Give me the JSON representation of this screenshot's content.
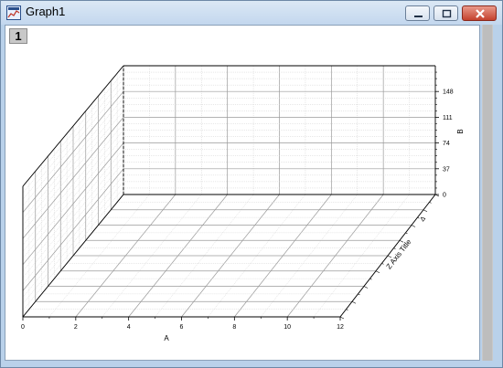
{
  "window": {
    "title": "Graph1",
    "icon": "origin-graph-icon",
    "controls": {
      "minimize": "minimize-icon",
      "maximize": "maximize-icon",
      "close": "close-icon"
    }
  },
  "layer": {
    "label": "1"
  },
  "chart_data": {
    "type": "3d-scatter",
    "x": {
      "label": "A",
      "ticks": [
        "0",
        "2",
        "4",
        "6",
        "8",
        "10",
        "12"
      ]
    },
    "y": {
      "label": "B",
      "ticks": [
        "0",
        "37",
        "74",
        "111",
        "148"
      ]
    },
    "z": {
      "label": "Z Axis Title",
      "ticks": [
        "Δ"
      ]
    },
    "series": [],
    "grid": true
  }
}
